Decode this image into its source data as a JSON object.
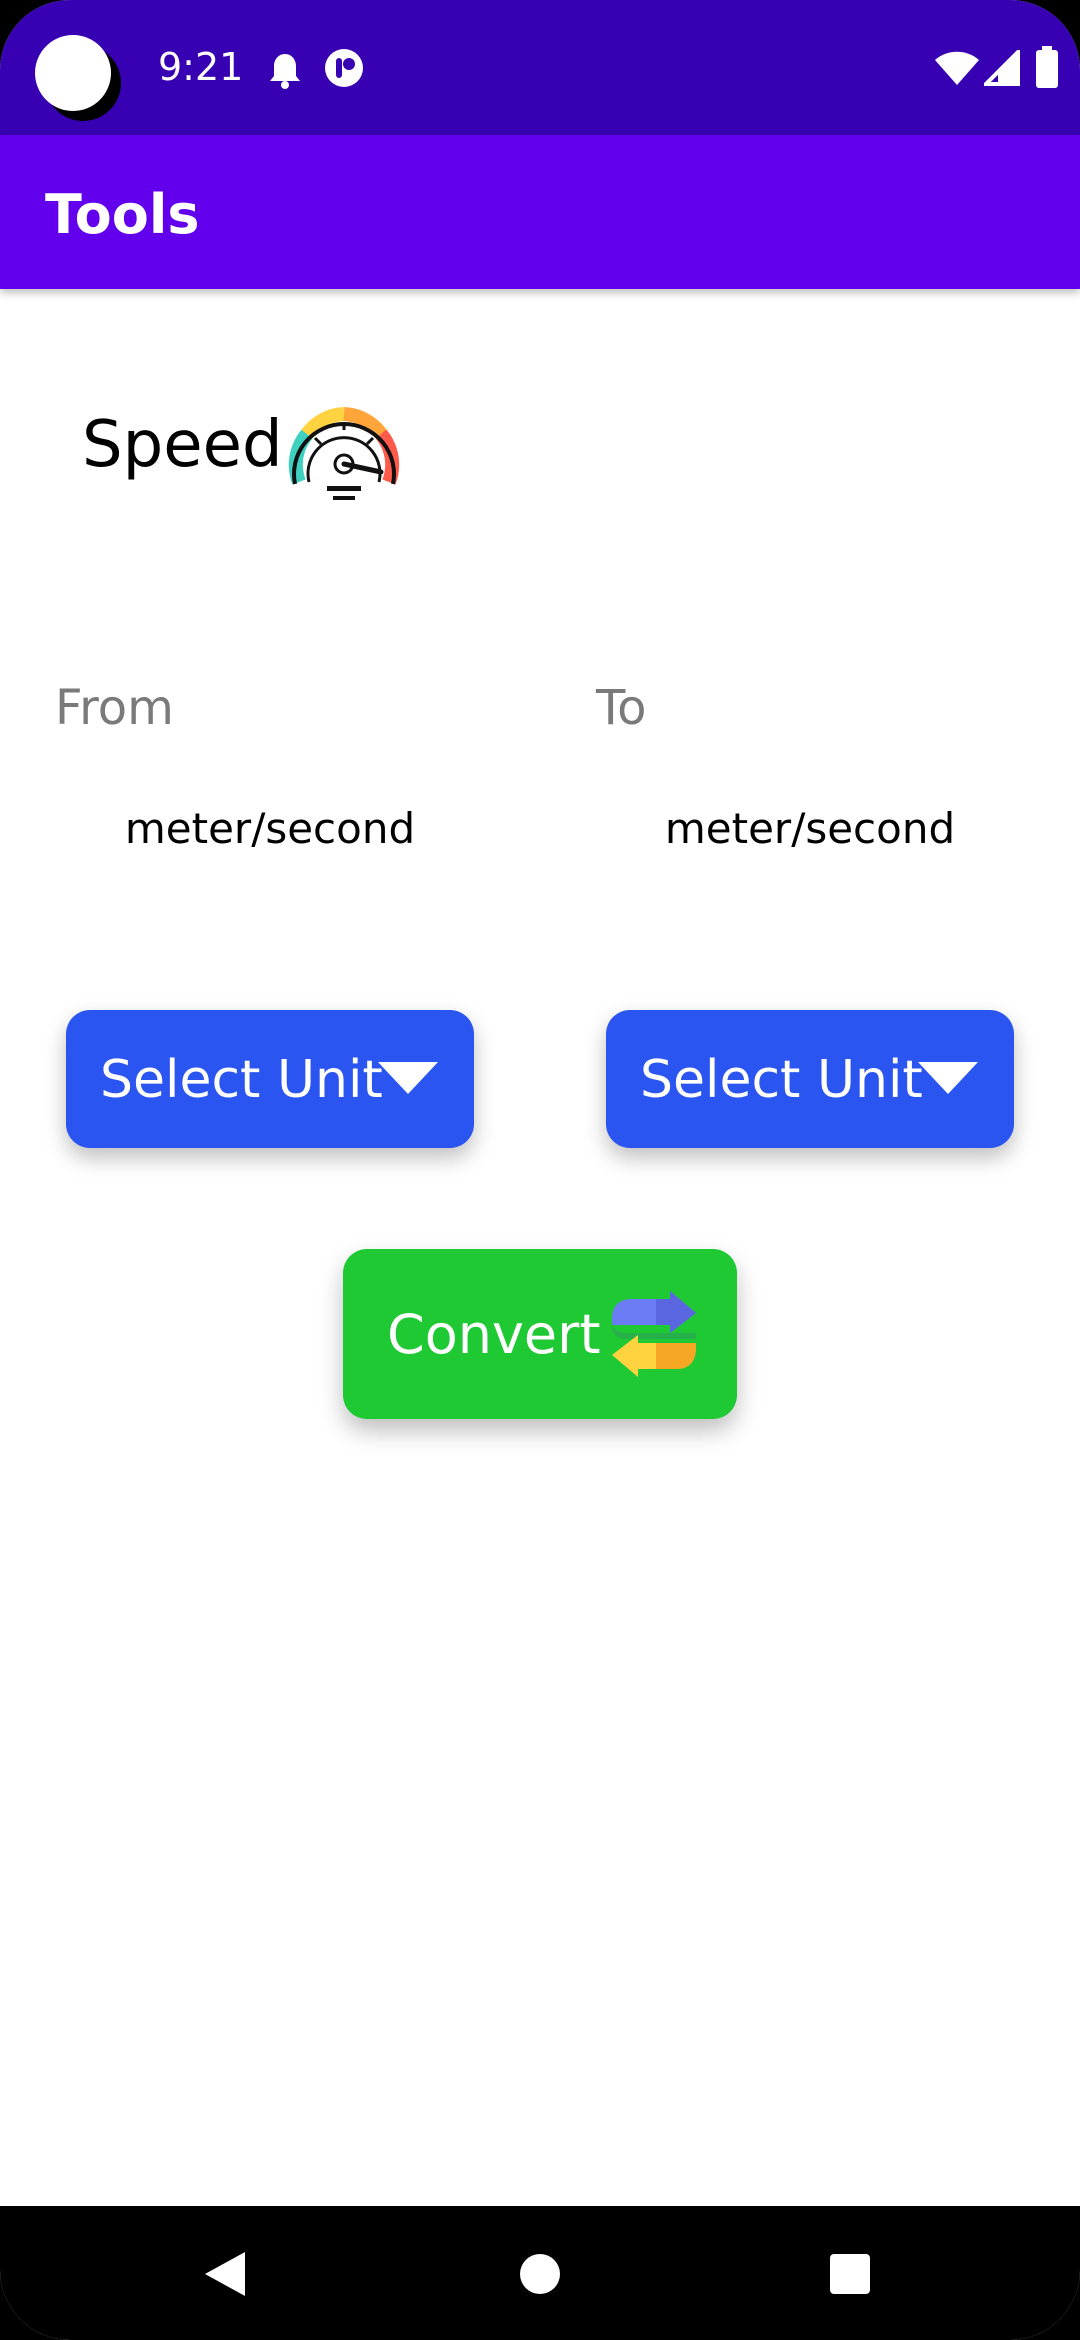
{
  "status_bar": {
    "time": "9:21",
    "left_icons": [
      "bell-icon",
      "notification-app-icon"
    ],
    "right_icons": [
      "wifi-icon",
      "signal-icon",
      "battery-icon"
    ]
  },
  "app_bar": {
    "title": "Tools"
  },
  "converter": {
    "heading": "Speed",
    "heading_icon": "speedometer-icon",
    "from": {
      "label": "From",
      "unit": "meter/second",
      "select_label": "Select Unit"
    },
    "to": {
      "label": "To",
      "unit": "meter/second",
      "select_label": "Select Unit"
    },
    "convert_label": "Convert",
    "convert_icon": "swap-arrows-icon"
  },
  "nav_bar": {
    "buttons": [
      "back-icon",
      "home-icon",
      "recents-icon"
    ]
  },
  "colors": {
    "status_bar": "#3700b3",
    "app_bar": "#6200ee",
    "select_button": "#2b55f0",
    "convert_button": "#1ec934"
  }
}
